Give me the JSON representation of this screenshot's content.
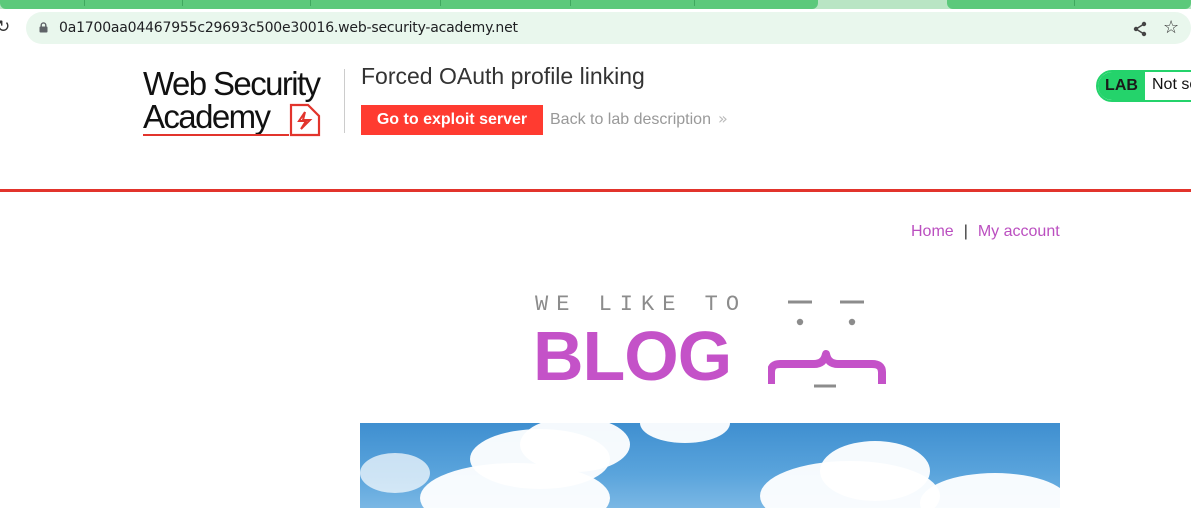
{
  "browser": {
    "url": "0a1700aa04467955c29693c500e30016.web-security-academy.net",
    "icons": [
      "reload-icon",
      "lock-icon",
      "share-icon",
      "star-icon"
    ]
  },
  "header": {
    "logo_line1": "Web Security",
    "logo_line2": "Academy",
    "lab_title": "Forced OAuth profile linking",
    "exploit_button": "Go to exploit server",
    "back_link": "Back to lab description",
    "back_chevron": "»",
    "status_badge": "LAB",
    "status_text": "Not solved"
  },
  "nav": {
    "home": "Home",
    "separator": "|",
    "my_account": "My account"
  },
  "banner": {
    "tagline": "WE LIKE TO",
    "word": "BLOG"
  },
  "colors": {
    "accent_red": "#e2342c",
    "exploit_button": "#ff3b30",
    "status_green": "#24d36b",
    "link_purple": "#bb4fc0",
    "banner_purple": "#c452c8"
  }
}
